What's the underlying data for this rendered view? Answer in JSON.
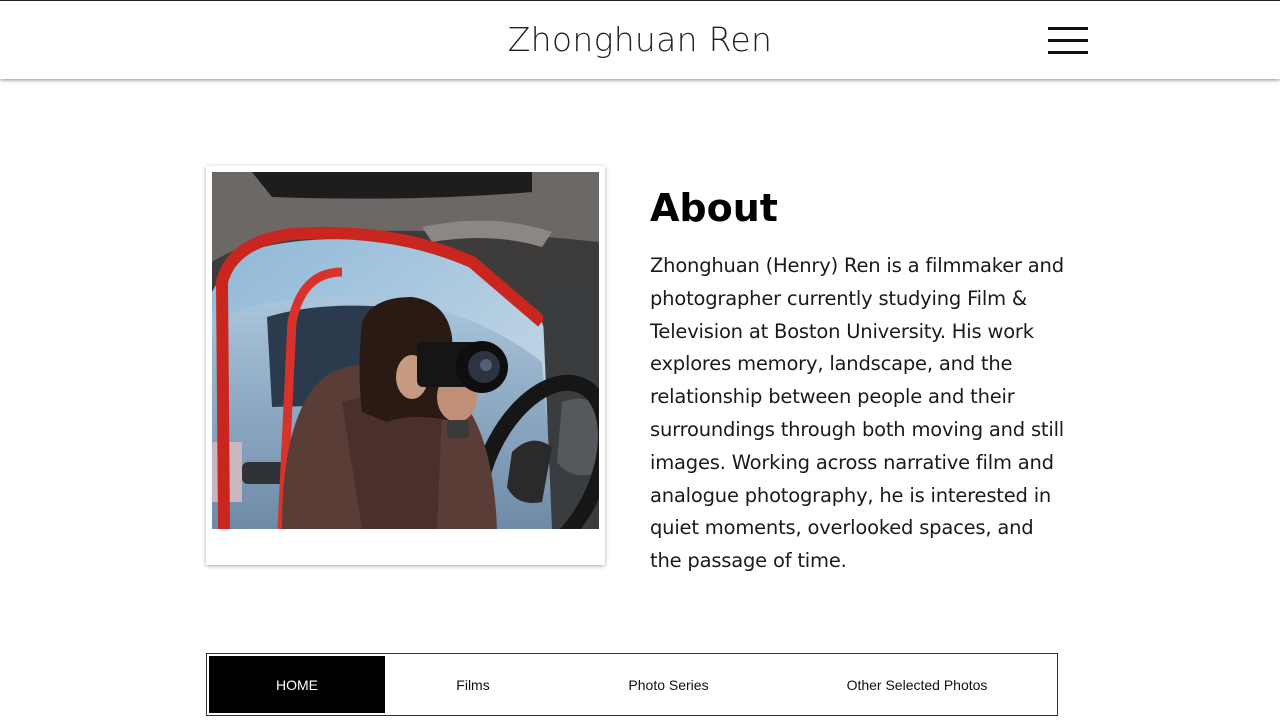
{
  "header": {
    "site_title": "Zhonghuan Ren",
    "menu_icon": "hamburger-menu-icon"
  },
  "about": {
    "photo_description": "photo-of-photographer-with-camera-in-car",
    "heading": "About",
    "body": "Zhonghuan (Henry) Ren is a filmmaker and photographer currently studying Film & Television at Boston University. His work explores memory, landscape, and the relationship between people and their surroundings through both moving and still images. Working across narrative film and analogue photography, he is interested in quiet moments, overlooked spaces, and the passage of time."
  },
  "nav": {
    "items": [
      {
        "label": "HOME",
        "active": true
      },
      {
        "label": "Films",
        "active": false
      },
      {
        "label": "Photo Series",
        "active": false
      },
      {
        "label": "Other Selected Photos",
        "active": false
      }
    ]
  },
  "colors": {
    "accent": "#000000",
    "background": "#ffffff",
    "text": "#1a1a1a"
  }
}
